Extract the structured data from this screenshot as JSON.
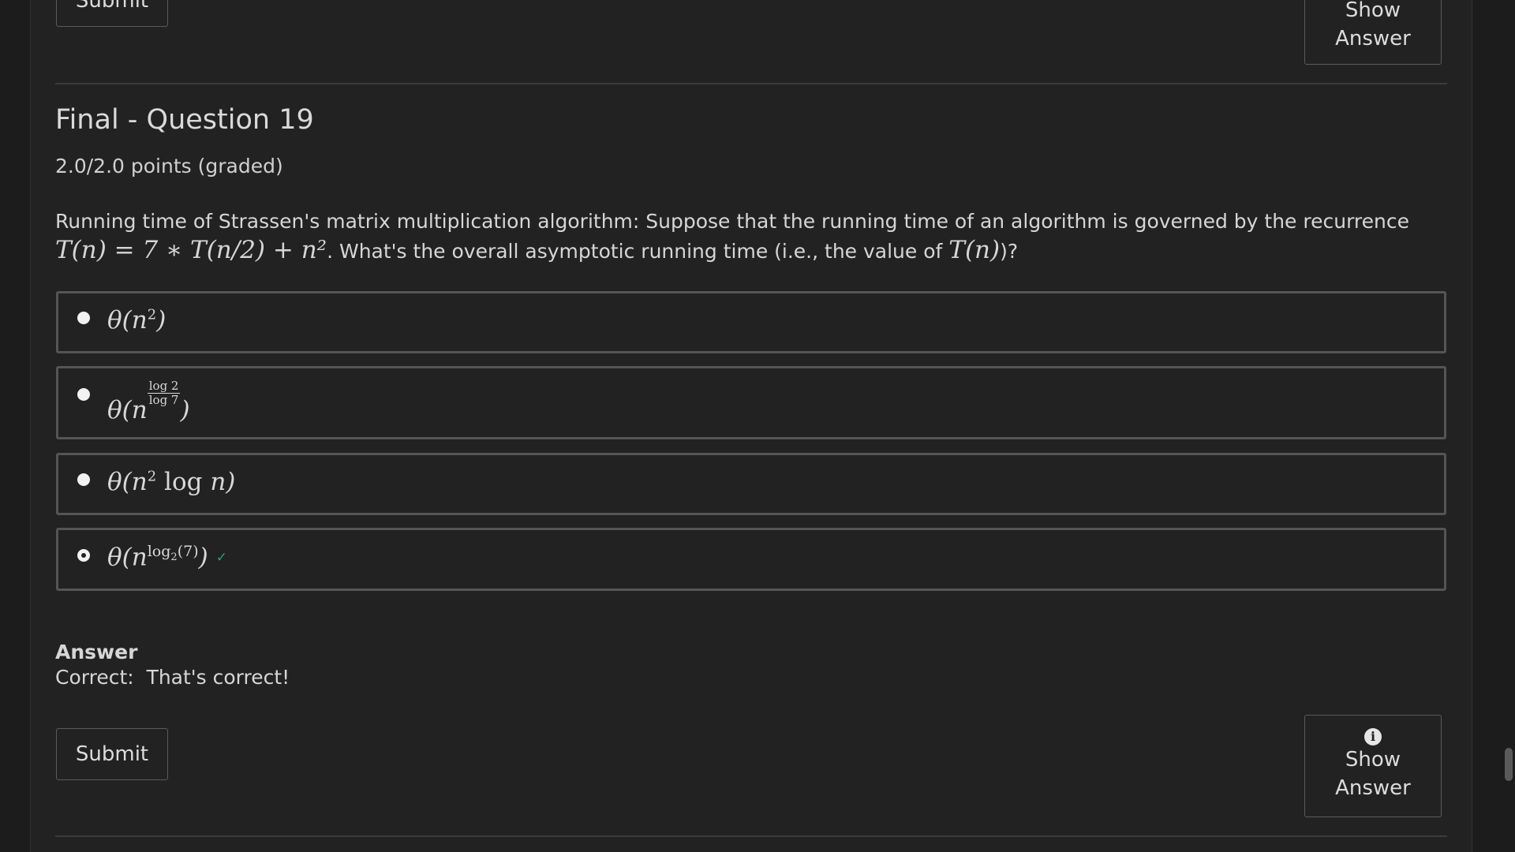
{
  "top": {
    "submit_label": "Submit",
    "show_answer_line1": "Show",
    "show_answer_line2": "Answer"
  },
  "question": {
    "title": "Final - Question 19",
    "points": "2.0/2.0 points (graded)",
    "text_part1": "Running time of Strassen's matrix multiplication algorithm: Suppose that the running time of an algorithm is governed by the recurrence",
    "recurrence": "T(n) = 7 ∗ T(n/2) + n²",
    "text_part2": ". What's the overall asymptotic running time (i.e., the value of ",
    "tn": "T(n)",
    "text_part3": ")?"
  },
  "options": [
    {
      "text": "θ(n²)",
      "selected": false
    },
    {
      "text": "θ(n^(log 2 / log 7))",
      "selected": false
    },
    {
      "text": "θ(n² log n)",
      "selected": false
    },
    {
      "text": "θ(n^(log₂(7)))",
      "selected": true,
      "status_icon": "check-icon",
      "status_color": "#1fa37e"
    }
  ],
  "answer": {
    "label": "Answer",
    "text": "Correct:  That's correct!"
  },
  "actions": {
    "submit_label": "Submit",
    "show_answer_line1": "Show",
    "show_answer_line2": "Answer",
    "info_icon": "info-icon"
  }
}
